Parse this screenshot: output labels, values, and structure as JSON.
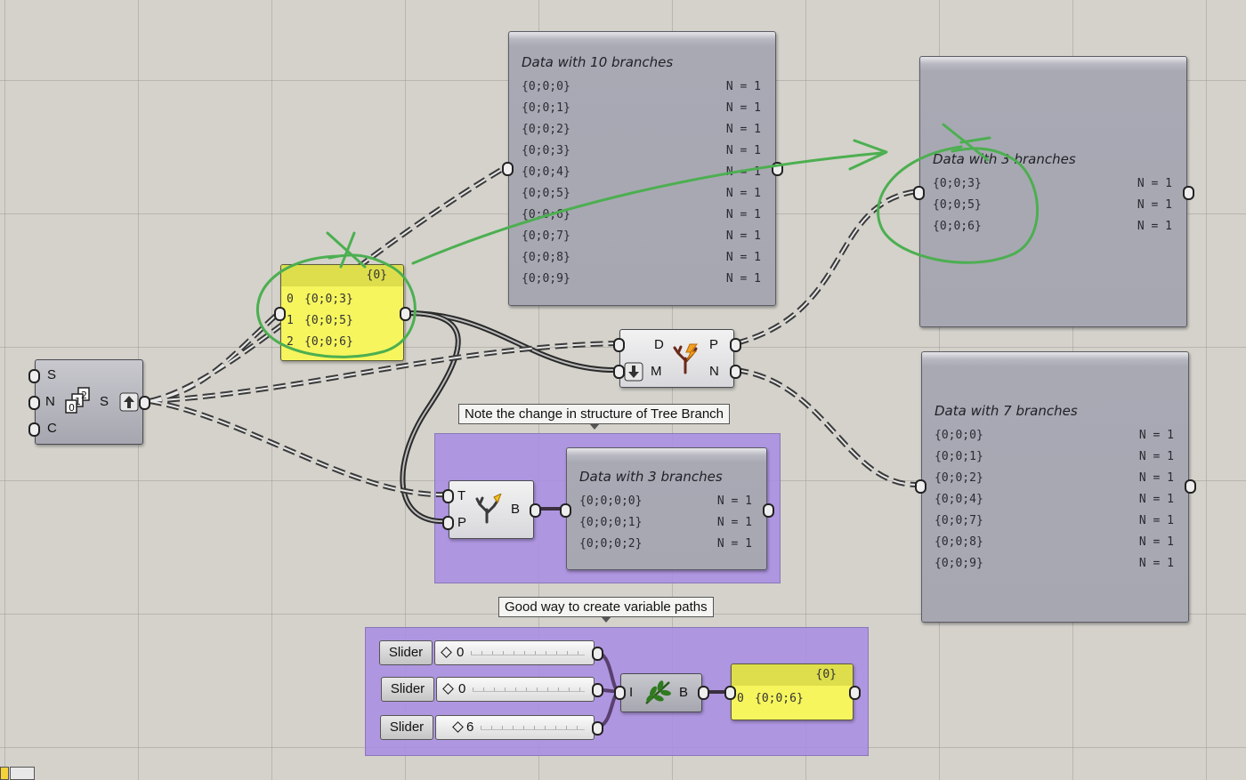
{
  "notes": {
    "tree_branch_note": "Note the change in structure of Tree Branch",
    "variable_paths_note": "Good way to create variable paths"
  },
  "panels": {
    "ten": {
      "title": "Data with 10 branches",
      "rows": [
        {
          "path": "{0;0;0}",
          "count": "N = 1"
        },
        {
          "path": "{0;0;1}",
          "count": "N = 1"
        },
        {
          "path": "{0;0;2}",
          "count": "N = 1"
        },
        {
          "path": "{0;0;3}",
          "count": "N = 1"
        },
        {
          "path": "{0;0;4}",
          "count": "N = 1"
        },
        {
          "path": "{0;0;5}",
          "count": "N = 1"
        },
        {
          "path": "{0;0;6}",
          "count": "N = 1"
        },
        {
          "path": "{0;0;7}",
          "count": "N = 1"
        },
        {
          "path": "{0;0;8}",
          "count": "N = 1"
        },
        {
          "path": "{0;0;9}",
          "count": "N = 1"
        }
      ]
    },
    "three_top": {
      "title": "Data with 3 branches",
      "rows": [
        {
          "path": "{0;0;3}",
          "count": "N = 1"
        },
        {
          "path": "{0;0;5}",
          "count": "N = 1"
        },
        {
          "path": "{0;0;6}",
          "count": "N = 1"
        }
      ]
    },
    "seven": {
      "title": "Data with 7 branches",
      "rows": [
        {
          "path": "{0;0;0}",
          "count": "N = 1"
        },
        {
          "path": "{0;0;1}",
          "count": "N = 1"
        },
        {
          "path": "{0;0;2}",
          "count": "N = 1"
        },
        {
          "path": "{0;0;4}",
          "count": "N = 1"
        },
        {
          "path": "{0;0;7}",
          "count": "N = 1"
        },
        {
          "path": "{0;0;8}",
          "count": "N = 1"
        },
        {
          "path": "{0;0;9}",
          "count": "N = 1"
        }
      ]
    },
    "three_bottom": {
      "title": "Data with 3 branches",
      "rows": [
        {
          "path": "{0;0;0;0}",
          "count": "N = 1"
        },
        {
          "path": "{0;0;0;1}",
          "count": "N = 1"
        },
        {
          "path": "{0;0;0;2}",
          "count": "N = 1"
        }
      ]
    }
  },
  "yellow_list": {
    "header": "{0}",
    "rows": [
      {
        "index": "0",
        "value": "{0;0;3}"
      },
      {
        "index": "1",
        "value": "{0;0;5}"
      },
      {
        "index": "2",
        "value": "{0;0;6}"
      }
    ]
  },
  "yellow_small": {
    "header": "{0}",
    "rows": [
      {
        "index": "0",
        "value": "{0;0;6}"
      }
    ]
  },
  "series_comp": {
    "inputs": [
      "S",
      "N",
      "C"
    ],
    "output": "S"
  },
  "dispatch_comp": {
    "inputs": [
      "D",
      "M"
    ],
    "outputs": [
      "P",
      "N"
    ]
  },
  "branch_comp": {
    "inputs": [
      "T",
      "P"
    ],
    "output": "B"
  },
  "path_comp": {
    "input": "I",
    "output": "B"
  },
  "sliders": [
    {
      "label": "Slider",
      "value": "0"
    },
    {
      "label": "Slider",
      "value": "0"
    },
    {
      "label": "Slider",
      "value": "6"
    }
  ],
  "colors": {
    "canvas": "#d4d2cb",
    "group": "#a88ce4",
    "panel": "#a9a9b4",
    "yellow": "#f6f55e",
    "annotation": "#4caf50"
  }
}
